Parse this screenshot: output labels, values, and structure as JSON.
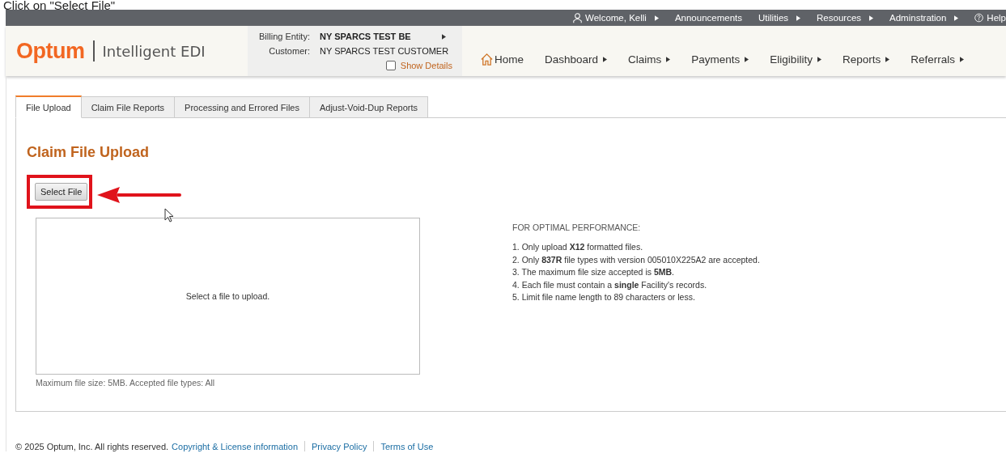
{
  "caption": "Click on \"Select File\"",
  "top_bar": [
    {
      "label": "Welcome, Kelli",
      "kind": "user",
      "has_menu": true
    },
    {
      "label": "Announcements",
      "kind": "plain",
      "has_menu": false
    },
    {
      "label": "Utilities",
      "kind": "plain",
      "has_menu": true
    },
    {
      "label": "Resources",
      "kind": "plain",
      "has_menu": true
    },
    {
      "label": "Adminstration",
      "kind": "plain",
      "has_menu": true
    },
    {
      "label": "Help",
      "kind": "help",
      "has_menu": false
    }
  ],
  "header": {
    "brand": "Optum",
    "product": "Intelligent EDI",
    "billing_entity": {
      "label": "Billing Entity:",
      "value": "NY SPARCS TEST BE",
      "has_menu": true
    },
    "customer": {
      "label": "Customer:",
      "value": "NY SPARCS TEST CUSTOMER"
    },
    "show_details": {
      "label": "Show Details",
      "checked": false
    }
  },
  "nav": [
    {
      "label": "Home",
      "kind": "home",
      "has_menu": false
    },
    {
      "label": "Dashboard",
      "kind": "menu",
      "has_menu": true
    },
    {
      "label": "Claims",
      "kind": "menu",
      "has_menu": true
    },
    {
      "label": "Payments",
      "kind": "menu",
      "has_menu": true
    },
    {
      "label": "Eligibility",
      "kind": "menu",
      "has_menu": true
    },
    {
      "label": "Reports",
      "kind": "menu",
      "has_menu": true
    },
    {
      "label": "Referrals",
      "kind": "menu",
      "has_menu": true
    }
  ],
  "tabs": [
    {
      "label": "File Upload",
      "selected": true
    },
    {
      "label": "Claim File Reports",
      "selected": false
    },
    {
      "label": "Processing and Errored Files",
      "selected": false
    },
    {
      "label": "Adjust-Void-Dup Reports",
      "selected": false
    }
  ],
  "page_title": "Claim File Upload",
  "select_button": {
    "label": "Select File",
    "highlighted": true
  },
  "drop_zone": {
    "placeholder": "Select a file to upload."
  },
  "drop_hint": "Maximum file size: 5MB. Accepted file types: All",
  "performance": {
    "title": "FOR OPTIMAL PERFORMANCE:",
    "rules": [
      "1. Only upload **X12** formatted files.",
      "2. Only **837R** file types with version 005010X225A2 are accepted.",
      "3. The maximum file size accepted is **5MB**.",
      "4. Each file must contain a **single** Facility's records.",
      "5. Limit file name length to 89 characters or less."
    ]
  },
  "footer": {
    "copyright": "© 2025 Optum, Inc. All rights reserved.",
    "links": [
      "Copyright & License information",
      "Privacy Policy",
      "Terms of Use"
    ]
  }
}
